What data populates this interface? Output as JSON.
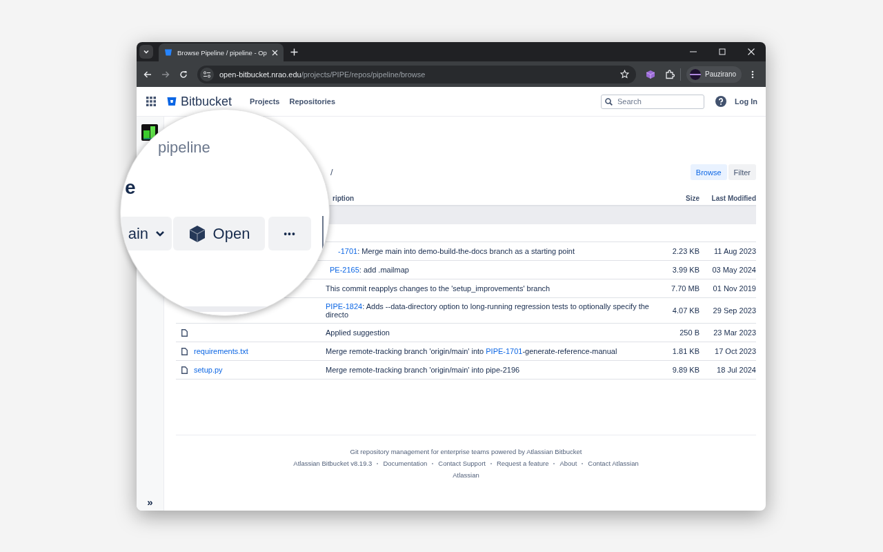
{
  "browser": {
    "tab_title": "Browse Pipeline / pipeline - Op",
    "url_host": "open-bitbucket.nrao.edu",
    "url_path": "/projects/PIPE/repos/pipeline/browse",
    "profile_name": "Pauzirano"
  },
  "header": {
    "brand": "Bitbucket",
    "nav": [
      "Projects",
      "Repositories"
    ],
    "search": {
      "placeholder": "Search"
    },
    "login": "Log In"
  },
  "sidebar": {
    "expand": "»"
  },
  "magnifier": {
    "repo_name": "pipeline",
    "heading_fragment": "e",
    "branch_fragment": "ain",
    "open_button": "Open",
    "more_button": "•••"
  },
  "breadcrumb_fragment": "/",
  "view_toggle": [
    {
      "label": "Browse",
      "selected": true
    },
    {
      "label": "Filter",
      "selected": false
    }
  ],
  "table": {
    "columns": [
      "ription",
      "Size",
      "Last Modified"
    ],
    "rows": [
      {
        "description": [
          {
            "text": "-1701",
            "link": true
          },
          {
            "text": ": Merge main into demo-build-the-docs branch as a starting point",
            "link": false
          }
        ],
        "size": "2.23 KB",
        "modified": "11 Aug 2023"
      },
      {
        "description": [
          {
            "text": "PE-2165",
            "link": true
          },
          {
            "text": ": add .mailmap",
            "link": false
          }
        ],
        "size": "3.99 KB",
        "modified": "03 May 2024"
      },
      {
        "description": [
          {
            "text": "This commit reapplys changes to the 'setup_improvements' branch",
            "link": false
          }
        ],
        "size": "7.70 MB",
        "modified": "01 Nov 2019"
      },
      {
        "description": [
          {
            "text": "PIPE-1824",
            "link": true
          },
          {
            "text": ": Adds --data-directory option to long-running regression tests to optionally specify the directo",
            "link": false
          }
        ],
        "size": "4.07 KB",
        "modified": "29 Sep 2023"
      },
      {
        "kind": "file",
        "description": [
          {
            "text": "Applied suggestion",
            "link": false
          }
        ],
        "size": "250 B",
        "modified": "23 Mar 2023"
      },
      {
        "kind": "file",
        "name": "requirements.txt",
        "description": [
          {
            "text": "Merge remote-tracking branch 'origin/main' into ",
            "link": false
          },
          {
            "text": "PIPE-1701",
            "link": true
          },
          {
            "text": "-generate-reference-manual",
            "link": false
          }
        ],
        "size": "1.81 KB",
        "modified": "17 Oct 2023"
      },
      {
        "kind": "file",
        "name": "setup.py",
        "description": [
          {
            "text": "Merge remote-tracking branch 'origin/main' into pipe-2196",
            "link": false
          }
        ],
        "size": "9.89 KB",
        "modified": "18 Jul 2024"
      }
    ]
  },
  "footer": {
    "tagline": "Git repository management for enterprise teams powered by Atlassian Bitbucket",
    "links": [
      "Atlassian Bitbucket v8.19.3",
      "Documentation",
      "Contact Support",
      "Request a feature",
      "About",
      "Contact Atlassian"
    ],
    "brand": "Atlassian"
  }
}
